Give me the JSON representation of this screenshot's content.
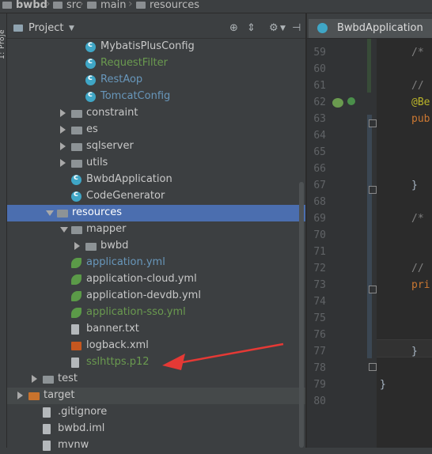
{
  "breadcrumb": [
    "bwbd",
    "src",
    "main",
    "resources"
  ],
  "sidebar_strip_label": "1: Proje",
  "project_panel": {
    "title": "Project",
    "tools": [
      "target-icon",
      "split-icon",
      "gear-icon",
      "hide-icon"
    ]
  },
  "tree": [
    {
      "label": "MybatisPlusConfig",
      "icon": "class",
      "color": "default",
      "depth": 3
    },
    {
      "label": "RequestFilter",
      "icon": "class",
      "color": "green",
      "depth": 3
    },
    {
      "label": "RestAop",
      "icon": "class",
      "color": "blue",
      "depth": 3
    },
    {
      "label": "TomcatConfig",
      "icon": "class",
      "color": "blue",
      "depth": 3
    },
    {
      "label": "constraint",
      "icon": "folder",
      "color": "default",
      "depth": 2,
      "arrow": "right"
    },
    {
      "label": "es",
      "icon": "folder",
      "color": "default",
      "depth": 2,
      "arrow": "right"
    },
    {
      "label": "sqlserver",
      "icon": "folder",
      "color": "default",
      "depth": 2,
      "arrow": "right"
    },
    {
      "label": "utils",
      "icon": "folder",
      "color": "default",
      "depth": 2,
      "arrow": "right"
    },
    {
      "label": "BwbdApplication",
      "icon": "class",
      "color": "default",
      "depth": 2
    },
    {
      "label": "CodeGenerator",
      "icon": "class",
      "color": "default",
      "depth": 2
    },
    {
      "label": "resources",
      "icon": "folder",
      "color": "default",
      "depth": 1,
      "arrow": "down",
      "selected": true
    },
    {
      "label": "mapper",
      "icon": "folder",
      "color": "default",
      "depth": 2,
      "arrow": "down"
    },
    {
      "label": "bwbd",
      "icon": "folder",
      "color": "default",
      "depth": 3,
      "arrow": "right"
    },
    {
      "label": "application.yml",
      "icon": "leaf",
      "color": "blue",
      "depth": 2
    },
    {
      "label": "application-cloud.yml",
      "icon": "leaf",
      "color": "default",
      "depth": 2
    },
    {
      "label": "application-devdb.yml",
      "icon": "leaf",
      "color": "default",
      "depth": 2
    },
    {
      "label": "application-sso.yml",
      "icon": "leaf",
      "color": "green",
      "depth": 2
    },
    {
      "label": "banner.txt",
      "icon": "file",
      "color": "default",
      "depth": 2
    },
    {
      "label": "logback.xml",
      "icon": "xml",
      "color": "default",
      "depth": 2
    },
    {
      "label": "sslhttps.p12",
      "icon": "file",
      "color": "green",
      "depth": 2
    },
    {
      "label": "test",
      "icon": "folder",
      "color": "default",
      "depth": 0,
      "arrow": "right"
    },
    {
      "label": "target",
      "icon": "folder-orange",
      "color": "default",
      "depth": -1,
      "arrow": "right",
      "hover": true
    },
    {
      "label": ".gitignore",
      "icon": "file",
      "color": "default",
      "depth": 0
    },
    {
      "label": "bwbd.iml",
      "icon": "file",
      "color": "default",
      "depth": 0
    },
    {
      "label": "mvnw",
      "icon": "file",
      "color": "default",
      "depth": 0
    }
  ],
  "editor": {
    "tab_label": "BwbdApplication",
    "line_numbers": [
      "59",
      "60",
      "61",
      "62",
      "63",
      "64",
      "65",
      "66",
      "67",
      "68",
      "69",
      "70",
      "71",
      "72",
      "73",
      "74",
      "75",
      "76",
      "77",
      "78",
      "79",
      "80"
    ],
    "code_lines": [
      {
        "line": "59",
        "text": "/*",
        "kind": "comment",
        "indent": 1
      },
      {
        "line": "61",
        "text": "//",
        "kind": "comment",
        "indent": 1
      },
      {
        "line": "62",
        "text": "@Be",
        "kind": "annot",
        "indent": 1
      },
      {
        "line": "63",
        "text": "pub",
        "kind": "kw",
        "indent": 1
      },
      {
        "line": "67",
        "text": "}",
        "kind": "brace",
        "indent": 1
      },
      {
        "line": "69",
        "text": "/*",
        "kind": "comment",
        "indent": 1
      },
      {
        "line": "72",
        "text": "//",
        "kind": "comment",
        "indent": 1
      },
      {
        "line": "73",
        "text": "pri",
        "kind": "kw",
        "indent": 1
      },
      {
        "line": "77",
        "text": "}",
        "kind": "brace",
        "indent": 1
      },
      {
        "line": "79",
        "text": "}",
        "kind": "brace",
        "indent": 0
      }
    ]
  },
  "colors": {
    "selection": "#4b6eaf",
    "annotation_arrow": "#e53935"
  }
}
